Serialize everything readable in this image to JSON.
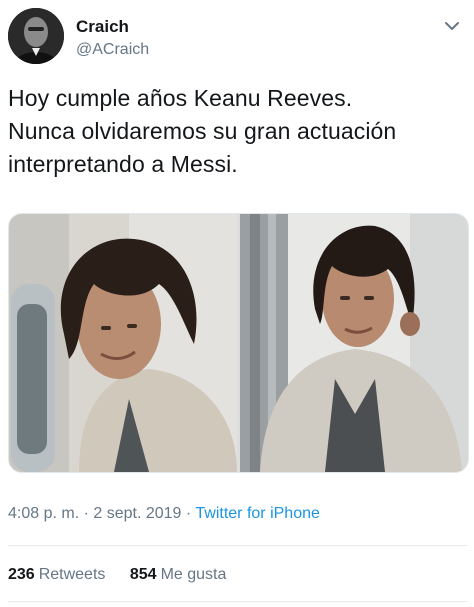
{
  "author": {
    "name": "Craich",
    "handle": "@ACraich"
  },
  "tweet": {
    "lines": [
      "Hoy cumple años Keanu Reeves.",
      "Nunca olvidaremos su gran actuación",
      "interpretando a Messi."
    ]
  },
  "meta": {
    "time": "4:08 p. m.",
    "separator1": " · ",
    "date": "2 sept. 2019",
    "separator2": " · ",
    "source": "Twitter for iPhone"
  },
  "stats": {
    "retweets_count": "236",
    "retweets_label": "Retweets",
    "likes_count": "854",
    "likes_label": "Me gusta"
  },
  "icons": {
    "menu": "chevron-down-icon"
  },
  "colors": {
    "link": "#1b95e0",
    "secondary_text": "#657786",
    "primary_text": "#14171a"
  }
}
